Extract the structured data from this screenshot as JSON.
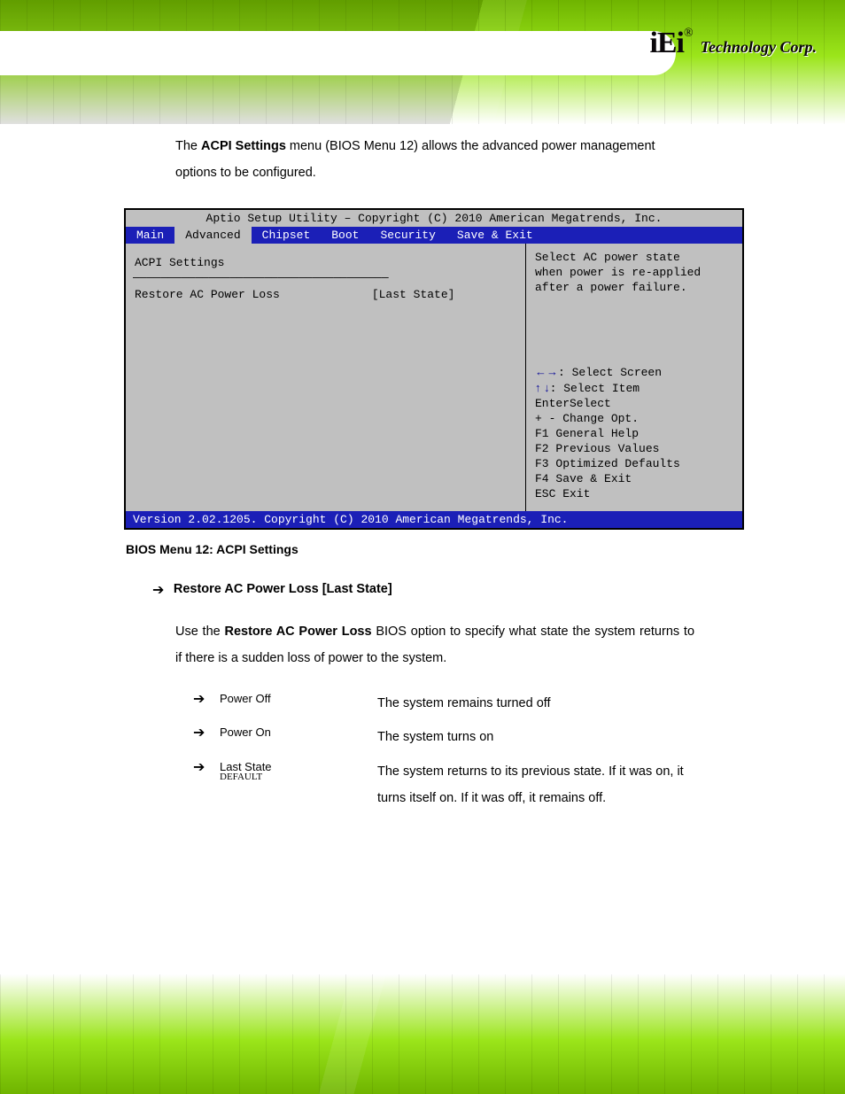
{
  "header": {
    "logo_reg": "®",
    "logo_name": "iEi",
    "logo_tag": "Technology Corp."
  },
  "intro": {
    "pre": "The ",
    "bold": "ACPI Settings",
    "post": " menu (BIOS Menu 12) allows the advanced power management options to be configured."
  },
  "bios": {
    "title": "Aptio Setup Utility – Copyright (C) 2010 American Megatrends, Inc.",
    "tabs": [
      "Main",
      "Advanced",
      "Chipset",
      "Boot",
      "Security",
      "Save & Exit"
    ],
    "active_tab_index": 1,
    "subtitle": "ACPI Settings",
    "option": {
      "label": "Restore AC Power Loss",
      "value": "[Last State]"
    },
    "help_lines": [
      "Select AC power state",
      "when power is re-applied",
      "after a power failure."
    ],
    "key_help": [
      {
        "arrows": "←→",
        "text": ": Select Screen"
      },
      {
        "arrows": "↑ ↓",
        "text": ": Select Item"
      },
      {
        "arrows": "",
        "text": "EnterSelect"
      },
      {
        "arrows": "",
        "text": "+ - Change Opt."
      },
      {
        "arrows": "",
        "text": "F1   General Help"
      },
      {
        "arrows": "",
        "text": "F2   Previous Values"
      },
      {
        "arrows": "",
        "text": "F3   Optimized Defaults"
      },
      {
        "arrows": "",
        "text": "F4   Save & Exit"
      },
      {
        "arrows": "",
        "text": "ESC  Exit"
      }
    ],
    "footer": "Version 2.02.1205. Copyright (C) 2010 American Megatrends, Inc."
  },
  "bios_caption": "BIOS Menu 12: ACPI Settings",
  "option_doc": {
    "heading": "Restore AC Power Loss [Last State]",
    "desc_pre": "Use the ",
    "desc_bold": "Restore AC Power Loss",
    "desc_post": " BIOS option to specify what state the system returns to if there is a sudden loss of power to the system.",
    "rows": [
      {
        "key": "Power Off",
        "default": "",
        "desc": "The system remains turned off"
      },
      {
        "key": "Power On",
        "default": "",
        "desc": "The system turns on"
      },
      {
        "key": "Last State",
        "default": "DEFAULT",
        "desc": "The system returns to its previous state. If it was on, it turns itself on. If it was off, it remains off."
      }
    ]
  }
}
